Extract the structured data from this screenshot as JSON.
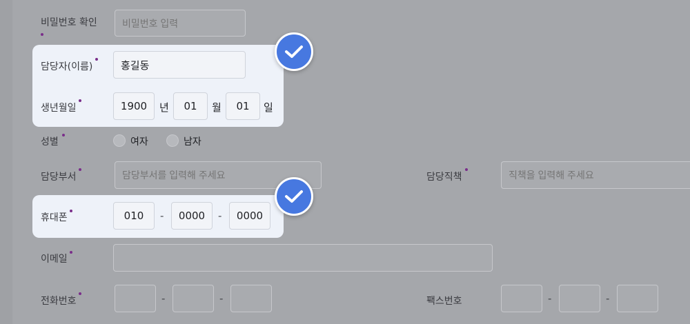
{
  "form": {
    "password_confirm": {
      "label": "비밀번호 확인",
      "placeholder": "비밀번호 입력"
    },
    "manager_name": {
      "label": "담당자(이름)",
      "value": "홍길동"
    },
    "birthdate": {
      "label": "생년월일",
      "year": "1900",
      "year_unit": "년",
      "month": "01",
      "month_unit": "월",
      "day": "01",
      "day_unit": "일"
    },
    "gender": {
      "label": "성별",
      "options": [
        "여자",
        "남자"
      ]
    },
    "department": {
      "label": "담당부서",
      "placeholder": "담당부서를 입력해 주세요"
    },
    "position": {
      "label": "담당직책",
      "placeholder": "직책을 입력해 주세요"
    },
    "mobile": {
      "label": "휴대폰",
      "part1": "010",
      "part2": "0000",
      "part3": "0000",
      "separator": "-"
    },
    "email": {
      "label": "이메일"
    },
    "phone": {
      "label": "전화번호",
      "separator": "-"
    },
    "fax": {
      "label": "팩스번호",
      "separator": "-"
    }
  },
  "colors": {
    "overlay": "#a5a7ab",
    "highlight_panel": "#eef2f9",
    "check_badge": "#4778e0",
    "required_dot": "#7a2e8a"
  },
  "icons": {
    "verified": "check-circle-icon"
  }
}
